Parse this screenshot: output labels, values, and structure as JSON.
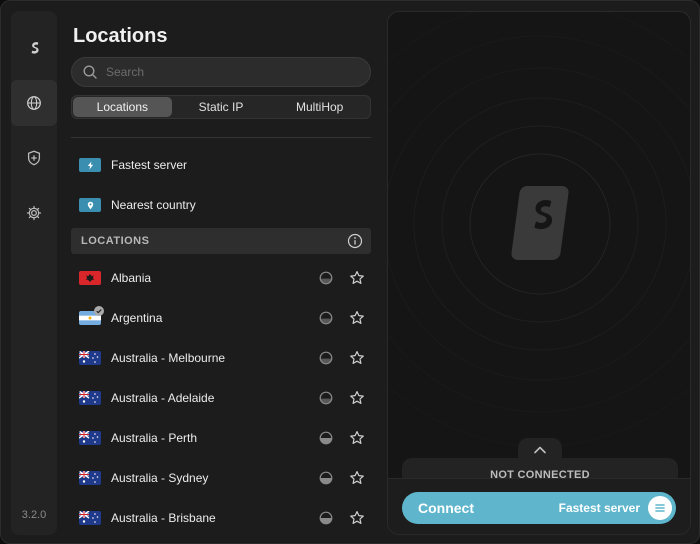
{
  "app": {
    "version": "3.2.0"
  },
  "sidebar": {
    "items": [
      {
        "name": "logo"
      },
      {
        "name": "locations",
        "active": true
      },
      {
        "name": "security"
      },
      {
        "name": "settings"
      }
    ]
  },
  "panel": {
    "title": "Locations",
    "search_placeholder": "Search",
    "tabs": [
      {
        "label": "Locations",
        "active": true
      },
      {
        "label": "Static IP",
        "active": false
      },
      {
        "label": "MultiHop",
        "active": false
      }
    ],
    "quick": [
      {
        "label": "Fastest server",
        "icon": "lightning-icon"
      },
      {
        "label": "Nearest country",
        "icon": "location-pin-icon"
      }
    ],
    "section_header": "LOCATIONS",
    "locations": [
      {
        "name": "Albania",
        "flag": "albania",
        "load": "light"
      },
      {
        "name": "Argentina",
        "flag": "argentina",
        "load": "light",
        "badge": true
      },
      {
        "name": "Australia - Melbourne",
        "flag": "australia",
        "load": "light"
      },
      {
        "name": "Australia - Adelaide",
        "flag": "australia",
        "load": "light"
      },
      {
        "name": "Australia - Perth",
        "flag": "australia",
        "load": "medium"
      },
      {
        "name": "Australia - Sydney",
        "flag": "australia",
        "load": "medium"
      },
      {
        "name": "Australia - Brisbane",
        "flag": "australia",
        "load": "medium"
      }
    ]
  },
  "status": {
    "text": "NOT CONNECTED"
  },
  "connect": {
    "label": "Connect",
    "server": "Fastest server"
  },
  "colors": {
    "accent": "#5fb6cc",
    "quick_icon": "#3a8fb0",
    "background": "#1c1c1c"
  }
}
